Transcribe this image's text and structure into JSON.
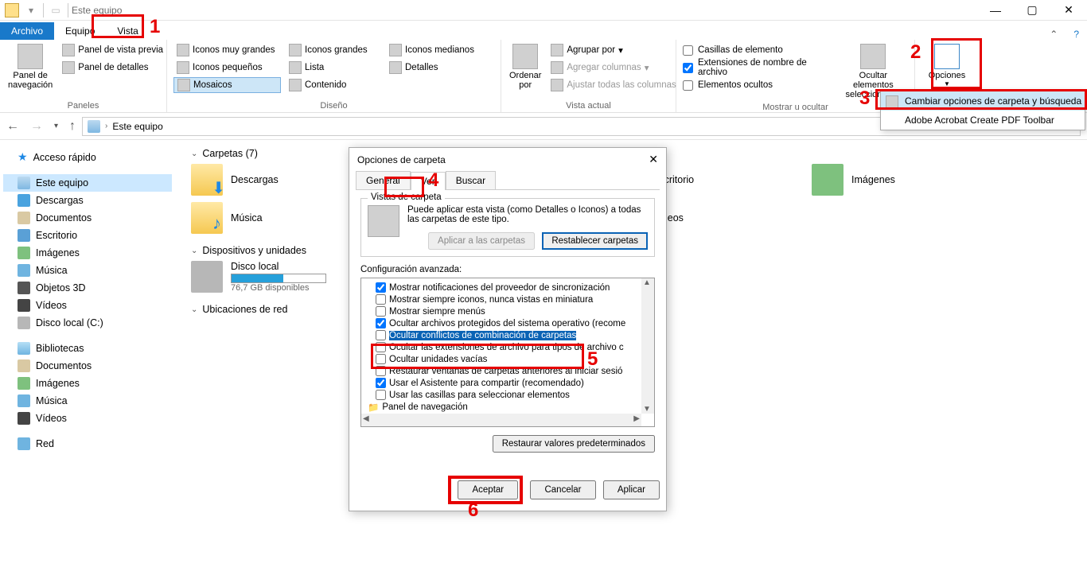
{
  "titlebar": {
    "title": "Este equipo"
  },
  "tabs": {
    "archivo": "Archivo",
    "equipo": "Equipo",
    "vista": "Vista"
  },
  "ribbon": {
    "paneles": {
      "title": "Paneles",
      "panel_nav": "Panel de\nnavegación",
      "vista_previa": "Panel de vista previa",
      "detalles": "Panel de detalles"
    },
    "diseno": {
      "title": "Diseño",
      "muy_grandes": "Iconos muy grandes",
      "grandes": "Iconos grandes",
      "medianos": "Iconos medianos",
      "pequenos": "Iconos pequeños",
      "lista": "Lista",
      "detalles": "Detalles",
      "mosaicos": "Mosaicos",
      "contenido": "Contenido"
    },
    "vista_actual": {
      "title": "Vista actual",
      "ordenar": "Ordenar\npor",
      "agrupar": "Agrupar por",
      "agregar_cols": "Agregar columnas",
      "ajustar": "Ajustar todas las columnas"
    },
    "mostrar": {
      "title": "Mostrar u ocultar",
      "casillas": "Casillas de elemento",
      "ext": "Extensiones de nombre de archivo",
      "ocultos": "Elementos ocultos",
      "ocultar_sel": "Ocultar elementos\nseleccionados"
    },
    "opciones": {
      "label": "Opciones",
      "menu1": "Cambiar opciones de carpeta y búsqueda",
      "menu2": "Adobe Acrobat Create PDF Toolbar"
    }
  },
  "addr": {
    "location": "Este equipo"
  },
  "sidebar": {
    "acceso": "Acceso rápido",
    "este_equipo": "Este equipo",
    "descargas": "Descargas",
    "documentos": "Documentos",
    "escritorio": "Escritorio",
    "imagenes": "Imágenes",
    "musica": "Música",
    "objetos3d": "Objetos 3D",
    "videos": "Vídeos",
    "disco_c": "Disco local (C:)",
    "bibliotecas": "Bibliotecas",
    "bib_doc": "Documentos",
    "bib_img": "Imágenes",
    "bib_mus": "Música",
    "bib_vid": "Vídeos",
    "red": "Red"
  },
  "content": {
    "carpetas": "Carpetas (7)",
    "dispositivos": "Dispositivos y unidades",
    "ubicaciones": "Ubicaciones de red",
    "tiles": {
      "descargas": "Descargas",
      "escritorio": "Escritorio",
      "imagenes": "Imágenes",
      "musica": "Música",
      "videos": "Vídeos",
      "disco_local": "Disco local",
      "disco_sub": "76,7 GB disponibles"
    }
  },
  "dialog": {
    "title": "Opciones de carpeta",
    "tab_general": "General",
    "tab_ver": "Ver",
    "tab_buscar": "Buscar",
    "vistas_group": "Vistas de carpeta",
    "vistas_text": "Puede aplicar esta vista (como Detalles o Iconos) a todas las carpetas de este tipo.",
    "aplicar_carpetas": "Aplicar a las carpetas",
    "restablecer": "Restablecer carpetas",
    "config_label": "Configuración avanzada:",
    "opts": [
      {
        "label": "Mostrar notificaciones del proveedor de sincronización",
        "checked": true
      },
      {
        "label": "Mostrar siempre iconos, nunca vistas en miniatura",
        "checked": false
      },
      {
        "label": "Mostrar siempre menús",
        "checked": false
      },
      {
        "label": "Ocultar archivos protegidos del sistema operativo (recome",
        "checked": true
      },
      {
        "label": "Ocultar conflictos de combinación de carpetas",
        "checked": false,
        "selected": true
      },
      {
        "label": "Ocultar las extensiones de archivo para tipos de archivo c",
        "checked": false
      },
      {
        "label": "Ocultar unidades vacías",
        "checked": false
      },
      {
        "label": "Restaurar ventanas de carpetas anteriores al iniciar sesió",
        "checked": false
      },
      {
        "label": "Usar el Asistente para compartir (recomendado)",
        "checked": true
      },
      {
        "label": "Usar las casillas para seleccionar elementos",
        "checked": false
      }
    ],
    "panel_nav": "Panel de navegación",
    "restaurar": "Restaurar valores predeterminados",
    "aceptar": "Aceptar",
    "cancelar": "Cancelar",
    "aplicar": "Aplicar"
  },
  "callouts": {
    "n1": "1",
    "n2": "2",
    "n3": "3",
    "n4": "4",
    "n5": "5",
    "n6": "6"
  }
}
